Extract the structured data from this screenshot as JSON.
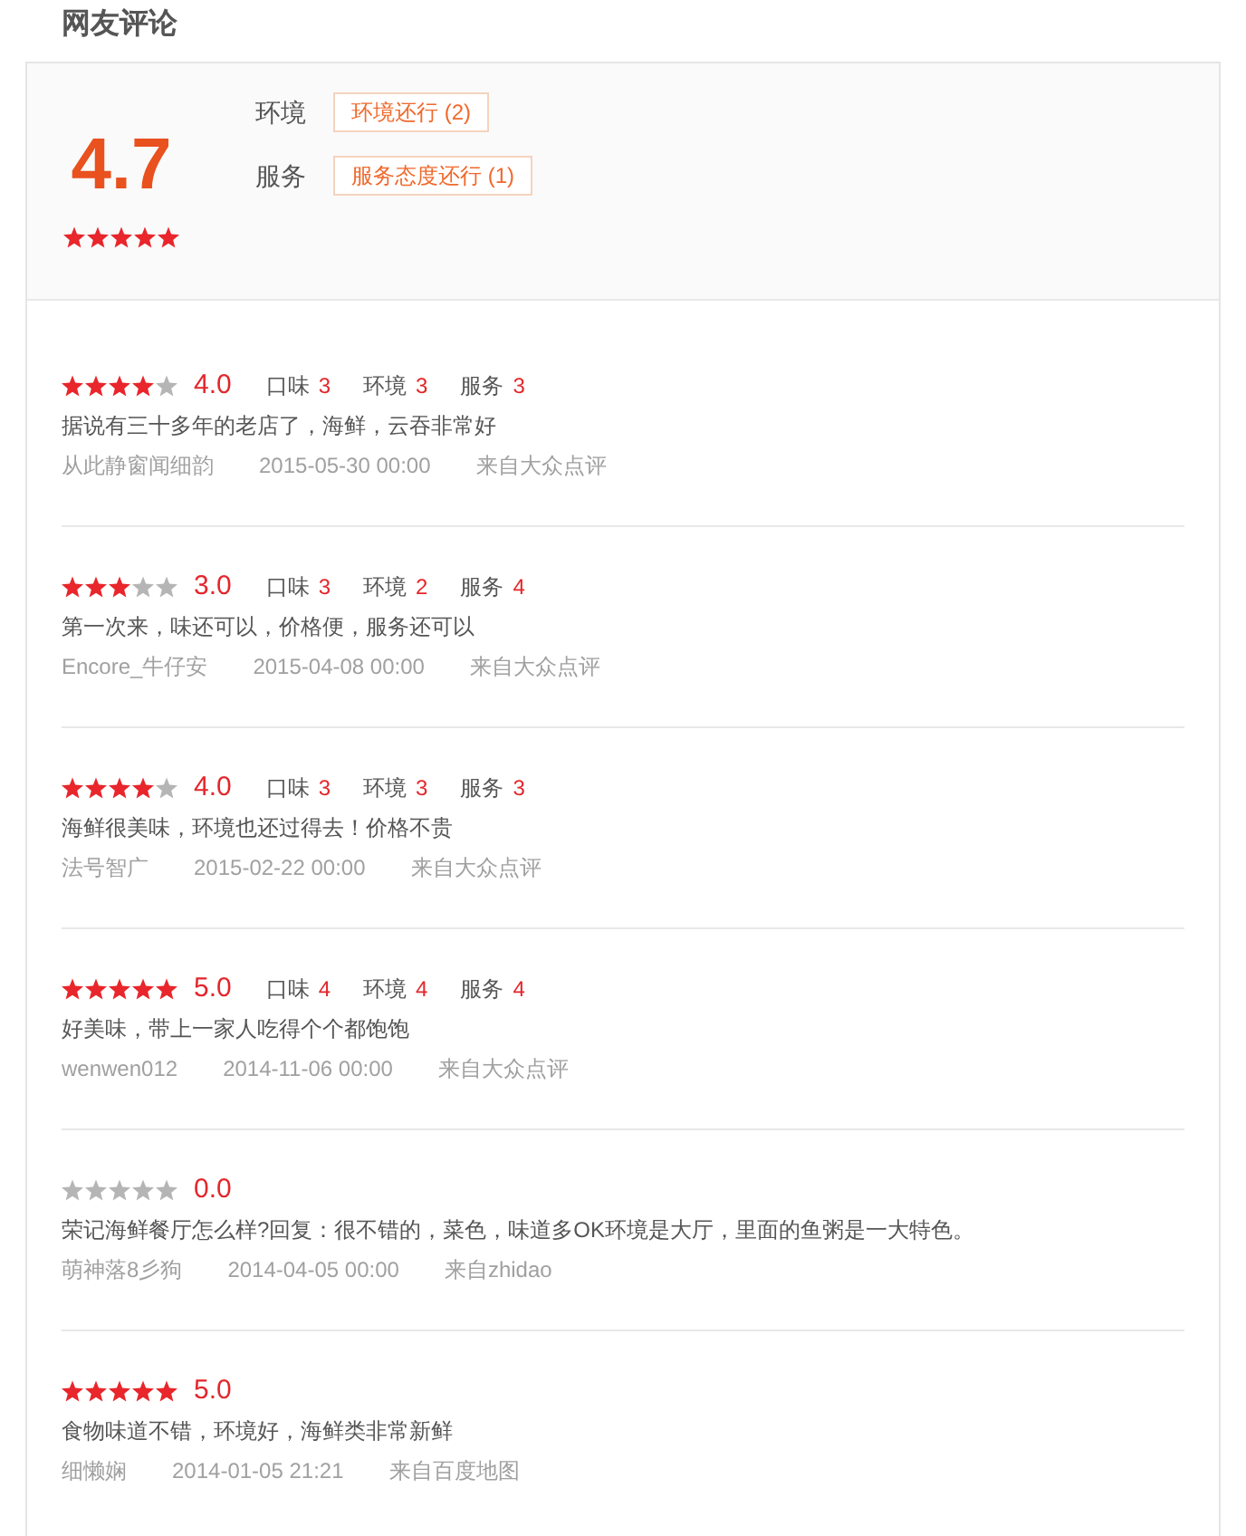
{
  "section_title": "网友评论",
  "summary": {
    "score": "4.7",
    "stars": 5,
    "aspects": [
      {
        "label": "环境",
        "tag": "环境还行 (2)"
      },
      {
        "label": "服务",
        "tag": "服务态度还行 (1)"
      }
    ]
  },
  "reviews": [
    {
      "stars": 4,
      "score": "4.0",
      "ratings": [
        {
          "label": "口味",
          "value": "3"
        },
        {
          "label": "环境",
          "value": "3"
        },
        {
          "label": "服务",
          "value": "3"
        }
      ],
      "comment": "据说有三十多年的老店了，海鲜，云吞非常好",
      "author": "从此静窗闻细韵",
      "time": "2015-05-30 00:00",
      "source": "来自大众点评"
    },
    {
      "stars": 3,
      "score": "3.0",
      "ratings": [
        {
          "label": "口味",
          "value": "3"
        },
        {
          "label": "环境",
          "value": "2"
        },
        {
          "label": "服务",
          "value": "4"
        }
      ],
      "comment": "第一次来，味还可以，价格便，服务还可以",
      "author": "Encore_牛仔安",
      "time": "2015-04-08 00:00",
      "source": "来自大众点评"
    },
    {
      "stars": 4,
      "score": "4.0",
      "ratings": [
        {
          "label": "口味",
          "value": "3"
        },
        {
          "label": "环境",
          "value": "3"
        },
        {
          "label": "服务",
          "value": "3"
        }
      ],
      "comment": "海鲜很美味，环境也还过得去！价格不贵",
      "author": "法号智广",
      "time": "2015-02-22 00:00",
      "source": "来自大众点评"
    },
    {
      "stars": 5,
      "score": "5.0",
      "ratings": [
        {
          "label": "口味",
          "value": "4"
        },
        {
          "label": "环境",
          "value": "4"
        },
        {
          "label": "服务",
          "value": "4"
        }
      ],
      "comment": "好美味，带上一家人吃得个个都饱饱",
      "author": "wenwen012",
      "time": "2014-11-06 00:00",
      "source": "来自大众点评"
    },
    {
      "stars": 0,
      "score": "0.0",
      "comment": "荣记海鲜餐厅怎么样?回复：很不错的，菜色，味道多OK环境是大厅，里面的鱼粥是一大特色。",
      "author": "萌神落8彡狗",
      "time": "2014-04-05 00:00",
      "source": "来自zhidao"
    },
    {
      "stars": 5,
      "score": "5.0",
      "comment": "食物味道不错，环境好，海鲜类非常新鲜",
      "author": "细懒娴",
      "time": "2014-01-05 21:21",
      "source": "来自百度地图"
    }
  ]
}
